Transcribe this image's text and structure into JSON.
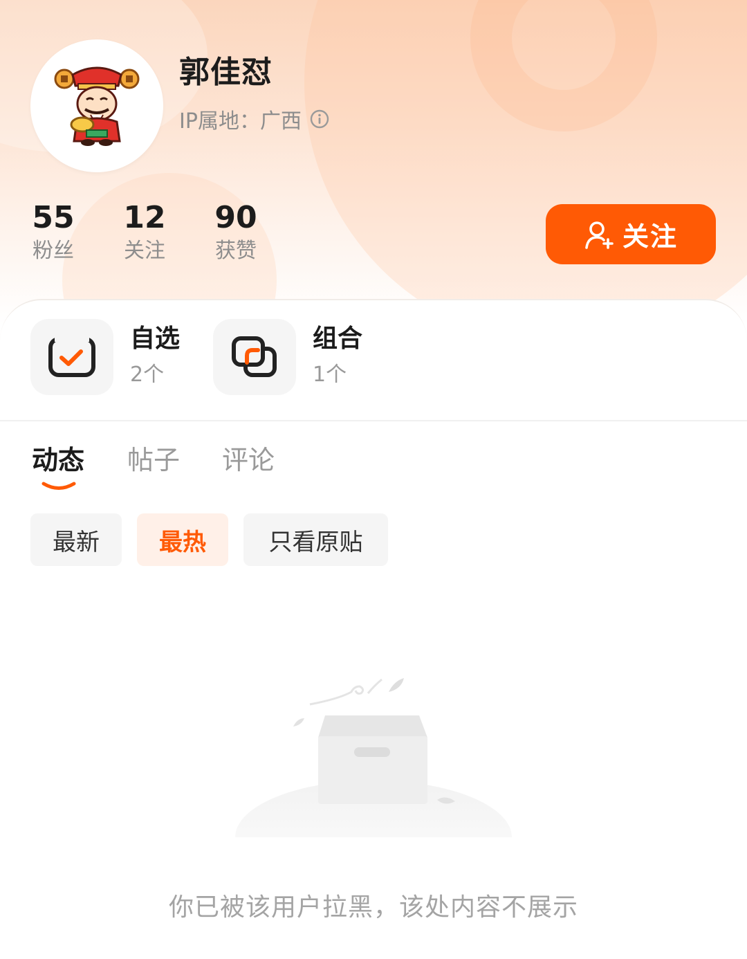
{
  "profile": {
    "username": "郭佳怼",
    "ip_location": "IP属地：广西",
    "follow_label": "关注"
  },
  "stats": [
    {
      "value": "55",
      "label": "粉丝"
    },
    {
      "value": "12",
      "label": "关注"
    },
    {
      "value": "90",
      "label": "获赞"
    }
  ],
  "quick_links": [
    {
      "title": "自选",
      "count": "2个"
    },
    {
      "title": "组合",
      "count": "1个"
    }
  ],
  "tabs": [
    {
      "label": "动态",
      "active": true
    },
    {
      "label": "帖子",
      "active": false
    },
    {
      "label": "评论",
      "active": false
    }
  ],
  "filters": [
    {
      "label": "最新",
      "active": false
    },
    {
      "label": "最热",
      "active": true
    },
    {
      "label": "只看原贴",
      "active": false
    }
  ],
  "empty_state": {
    "message": "你已被该用户拉黑，该处内容不展示"
  },
  "colors": {
    "accent": "#ff5a05",
    "accent_light": "#fff0e8",
    "text_primary": "#1c1c1c",
    "text_secondary": "#8d8d8d"
  },
  "icons": {
    "avatar": "fortune-god-avatar",
    "info": "info-icon",
    "follow": "add-user-icon",
    "watchlist": "checkbox-icon",
    "portfolio": "overlap-squares-icon",
    "empty": "empty-box-illustration"
  }
}
